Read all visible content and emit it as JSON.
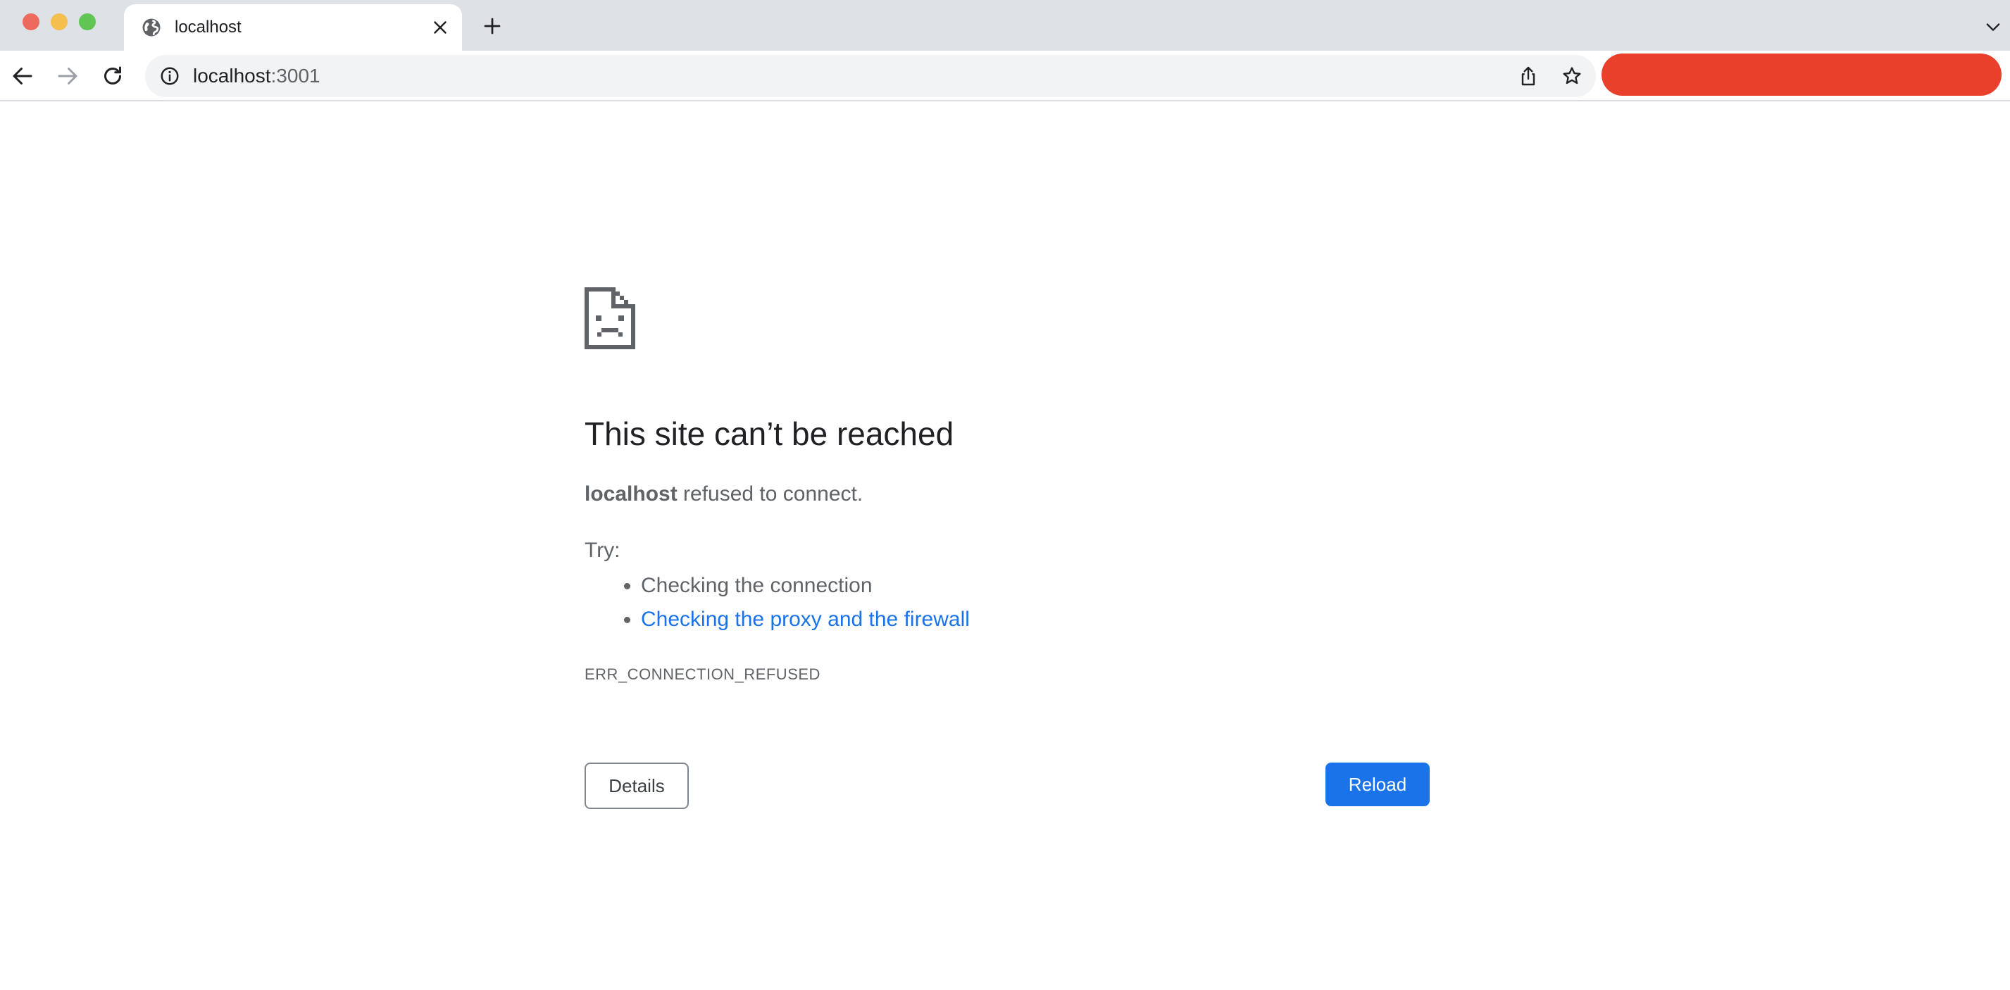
{
  "window": {
    "controls": [
      "close",
      "minimize",
      "zoom"
    ]
  },
  "tabs": [
    {
      "title": "localhost",
      "active": true,
      "favicon": "globe-icon"
    }
  ],
  "toolbar": {
    "url_host": "localhost",
    "url_port": ":3001"
  },
  "error": {
    "title": "This site can’t be reached",
    "host": "localhost",
    "message_suffix": " refused to connect.",
    "try_label": "Try:",
    "suggestions": [
      {
        "text": "Checking the connection",
        "link": false
      },
      {
        "text": "Checking the proxy and the firewall",
        "link": true
      }
    ],
    "code": "ERR_CONNECTION_REFUSED",
    "details_label": "Details",
    "reload_label": "Reload"
  },
  "colors": {
    "tab_strip": "#dee1e6",
    "link": "#1a73e8",
    "primary_button": "#1a73e8",
    "profile_pill": "#e8402a",
    "text_secondary": "#5f6368"
  }
}
